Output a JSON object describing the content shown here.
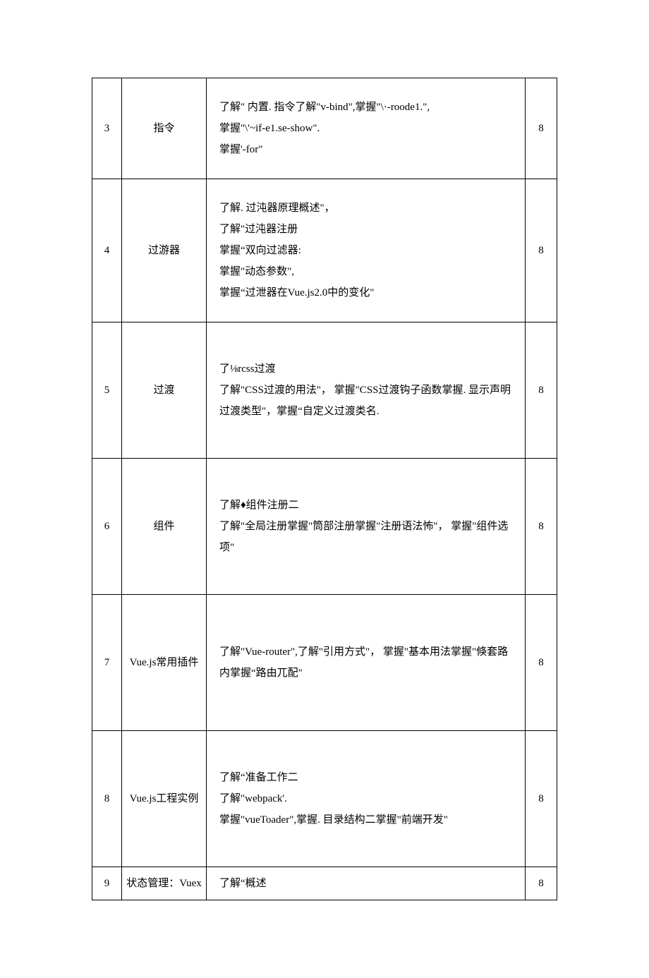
{
  "rows": [
    {
      "num": "3",
      "topic": "指令",
      "desc": "了解\" 内置. 指令了解\"v-bind\",掌握\"\\·-roode1.\",\n掌握\"\\'~if-e1.se-show\".\n掌握'-for\"",
      "hours": "8"
    },
    {
      "num": "4",
      "topic": "过游器",
      "desc": "了解. 过沌器原理概述\"，\n了解\"过沌器注册\n掌握“双向过滤器:\n掌握\"动态参数\",\n掌握“过泄器在Vue.js2.0中的变化\"",
      "hours": "8"
    },
    {
      "num": "5",
      "topic": "过渡",
      "desc": "了⅛rcss过渡\n了解\"CSS过渡的用法\"， 掌握\"CSS过渡钩子函数掌握. 显示声明过渡类型\"，掌握“自定义过渡类名.",
      "hours": "8"
    },
    {
      "num": "6",
      "topic": "组件",
      "desc": "了解♦组件注册二\n了解\"全局注册掌握\"筒部注册掌握\"注册语法怖\"， 掌握\"组件选项\"",
      "hours": "8"
    },
    {
      "num": "7",
      "topic": "Vue.js常用插件",
      "desc": "了解\"Vue-router\",了解\"引用方式\"， 掌握\"基本用法掌握\"倏套路内掌握“路由兀配\"",
      "hours": "8"
    },
    {
      "num": "8",
      "topic": "Vue.js工程实例",
      "desc": "了解“准备工作二\n了解\"webpack'.\n掌握\"vueToader\",掌握. 目录结构二掌握\"前端开发\"",
      "hours": "8"
    },
    {
      "num": "9",
      "topic": "状态管理：Vuex",
      "desc": "了解“概述",
      "hours": "8"
    }
  ]
}
